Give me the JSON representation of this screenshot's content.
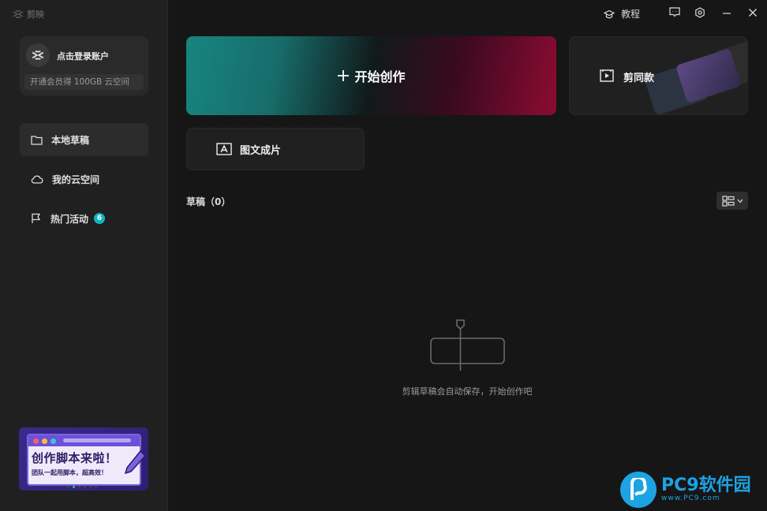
{
  "app": {
    "name": "剪映"
  },
  "account": {
    "login_label": "点击登录账户",
    "vip_label": "开通会员得 100GB 云空间"
  },
  "nav": {
    "items": [
      {
        "label": "本地草稿",
        "icon": "folder-icon",
        "active": true
      },
      {
        "label": "我的云空间",
        "icon": "cloud-icon",
        "active": false
      },
      {
        "label": "热门活动",
        "icon": "flag-icon",
        "active": false,
        "badge": "6"
      }
    ]
  },
  "banner": {
    "title": "创作脚本来啦！",
    "subtitle": "团队一起用脚本，超高效！"
  },
  "topbar": {
    "tutorial_label": "教程"
  },
  "main": {
    "start_label": "开始创作",
    "template_label": "剪同款",
    "imgtext_label": "图文成片",
    "drafts_title": "草稿（0）",
    "empty_text": "剪辑草稿会自动保存，开始创作吧"
  },
  "watermark": {
    "brand": "PC9软件园",
    "url": "www.PC9.com"
  },
  "colors": {
    "accent": "#0fb5c0",
    "start_gradient_left": "#17857f",
    "start_gradient_right": "#8c0b33"
  }
}
